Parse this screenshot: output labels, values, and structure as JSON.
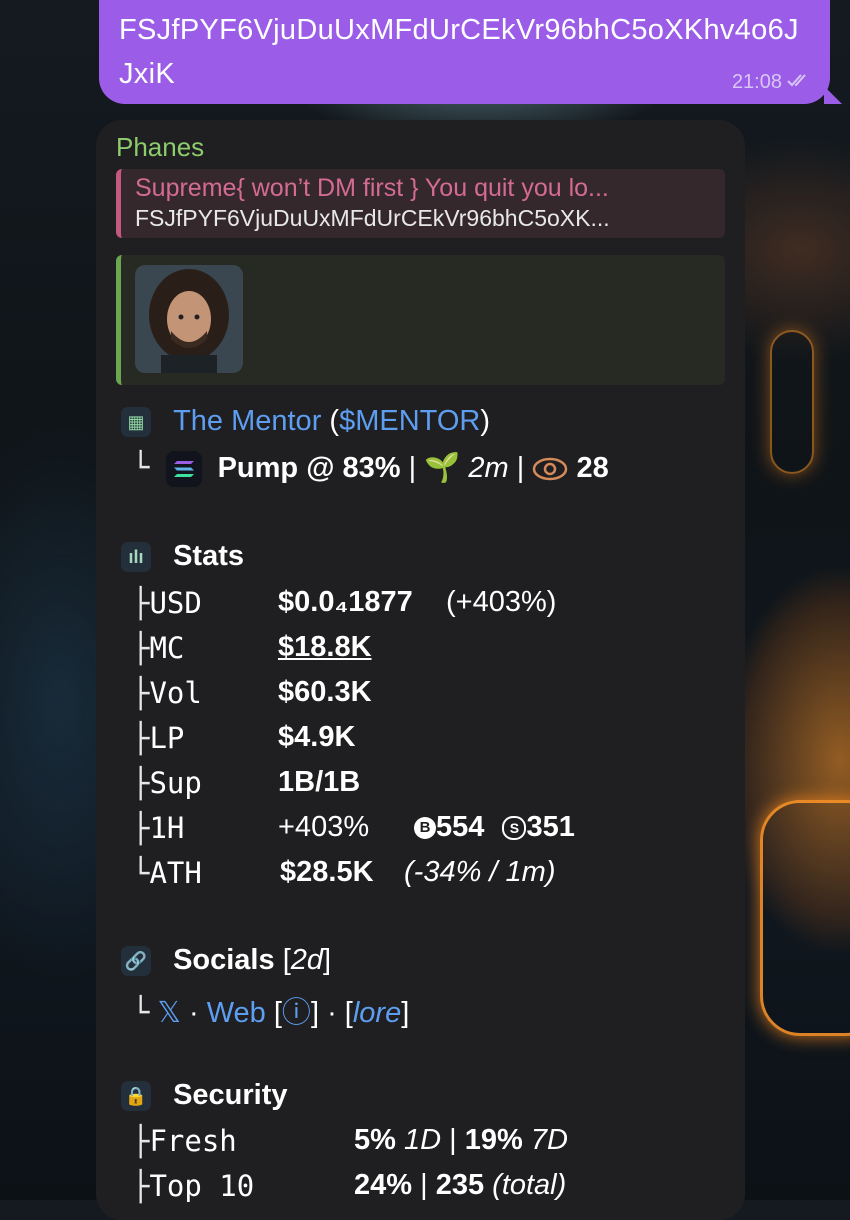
{
  "outgoing": {
    "text": "FSJfPYF6VjuDuUxMFdUrCEkVr96bhC5oXKhv4o6JJxiK",
    "time": "21:08"
  },
  "incoming": {
    "sender": "Phanes",
    "reply_title": "Supreme{ won’t DM first } You quit you lo...",
    "reply_text": "FSJfPYF6VjuDuUxMFdUrCEkVr96bhC5oXK...",
    "token_name": "The Mentor",
    "token_ticker": "$MENTOR",
    "pump": "Pump @ 83%",
    "age": "2m",
    "views": "28",
    "stats_title": "Stats",
    "stats": [
      {
        "label": "USD",
        "value": "$0.0₄1877",
        "extra": "(+403%)"
      },
      {
        "label": "MC",
        "value": "$18.8K",
        "extra": ""
      },
      {
        "label": "Vol",
        "value": "$60.3K",
        "extra": ""
      },
      {
        "label": "LP",
        "value": "$4.9K",
        "extra": ""
      },
      {
        "label": "Sup",
        "value": "1B/1B",
        "extra": ""
      },
      {
        "label": "1H",
        "value": "+403%",
        "buys": "554",
        "sells": "351"
      },
      {
        "label": "ATH",
        "value": "$28.5K",
        "extra": "(-34% / 1m)"
      }
    ],
    "socials_title": "Socials",
    "socials_age": "2d",
    "socials_x": "𝕏",
    "socials_web": "Web",
    "socials_info": "ⓘ",
    "socials_lore": "lore",
    "security_title": "Security",
    "security": [
      {
        "label": "Fresh",
        "v1": "5%",
        "p1": "1D",
        "v2": "19%",
        "p2": "7D"
      },
      {
        "label": "Top 10",
        "v1": "24%",
        "v2": "235",
        "p2": "(total)"
      }
    ]
  }
}
